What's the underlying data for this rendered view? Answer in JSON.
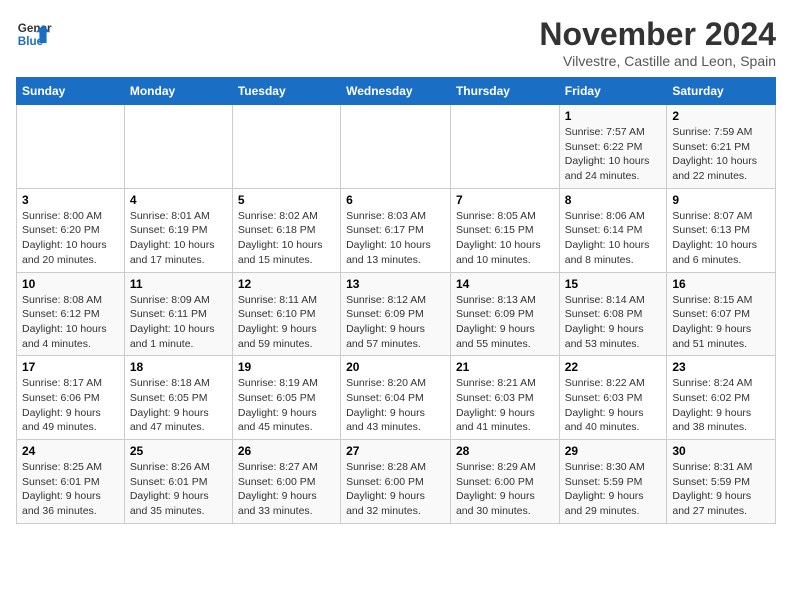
{
  "header": {
    "logo_line1": "General",
    "logo_line2": "Blue",
    "month": "November 2024",
    "location": "Vilvestre, Castille and Leon, Spain"
  },
  "weekdays": [
    "Sunday",
    "Monday",
    "Tuesday",
    "Wednesday",
    "Thursday",
    "Friday",
    "Saturday"
  ],
  "weeks": [
    [
      {
        "day": "",
        "info": ""
      },
      {
        "day": "",
        "info": ""
      },
      {
        "day": "",
        "info": ""
      },
      {
        "day": "",
        "info": ""
      },
      {
        "day": "",
        "info": ""
      },
      {
        "day": "1",
        "info": "Sunrise: 7:57 AM\nSunset: 6:22 PM\nDaylight: 10 hours and 24 minutes."
      },
      {
        "day": "2",
        "info": "Sunrise: 7:59 AM\nSunset: 6:21 PM\nDaylight: 10 hours and 22 minutes."
      }
    ],
    [
      {
        "day": "3",
        "info": "Sunrise: 8:00 AM\nSunset: 6:20 PM\nDaylight: 10 hours and 20 minutes."
      },
      {
        "day": "4",
        "info": "Sunrise: 8:01 AM\nSunset: 6:19 PM\nDaylight: 10 hours and 17 minutes."
      },
      {
        "day": "5",
        "info": "Sunrise: 8:02 AM\nSunset: 6:18 PM\nDaylight: 10 hours and 15 minutes."
      },
      {
        "day": "6",
        "info": "Sunrise: 8:03 AM\nSunset: 6:17 PM\nDaylight: 10 hours and 13 minutes."
      },
      {
        "day": "7",
        "info": "Sunrise: 8:05 AM\nSunset: 6:15 PM\nDaylight: 10 hours and 10 minutes."
      },
      {
        "day": "8",
        "info": "Sunrise: 8:06 AM\nSunset: 6:14 PM\nDaylight: 10 hours and 8 minutes."
      },
      {
        "day": "9",
        "info": "Sunrise: 8:07 AM\nSunset: 6:13 PM\nDaylight: 10 hours and 6 minutes."
      }
    ],
    [
      {
        "day": "10",
        "info": "Sunrise: 8:08 AM\nSunset: 6:12 PM\nDaylight: 10 hours and 4 minutes."
      },
      {
        "day": "11",
        "info": "Sunrise: 8:09 AM\nSunset: 6:11 PM\nDaylight: 10 hours and 1 minute."
      },
      {
        "day": "12",
        "info": "Sunrise: 8:11 AM\nSunset: 6:10 PM\nDaylight: 9 hours and 59 minutes."
      },
      {
        "day": "13",
        "info": "Sunrise: 8:12 AM\nSunset: 6:09 PM\nDaylight: 9 hours and 57 minutes."
      },
      {
        "day": "14",
        "info": "Sunrise: 8:13 AM\nSunset: 6:09 PM\nDaylight: 9 hours and 55 minutes."
      },
      {
        "day": "15",
        "info": "Sunrise: 8:14 AM\nSunset: 6:08 PM\nDaylight: 9 hours and 53 minutes."
      },
      {
        "day": "16",
        "info": "Sunrise: 8:15 AM\nSunset: 6:07 PM\nDaylight: 9 hours and 51 minutes."
      }
    ],
    [
      {
        "day": "17",
        "info": "Sunrise: 8:17 AM\nSunset: 6:06 PM\nDaylight: 9 hours and 49 minutes."
      },
      {
        "day": "18",
        "info": "Sunrise: 8:18 AM\nSunset: 6:05 PM\nDaylight: 9 hours and 47 minutes."
      },
      {
        "day": "19",
        "info": "Sunrise: 8:19 AM\nSunset: 6:05 PM\nDaylight: 9 hours and 45 minutes."
      },
      {
        "day": "20",
        "info": "Sunrise: 8:20 AM\nSunset: 6:04 PM\nDaylight: 9 hours and 43 minutes."
      },
      {
        "day": "21",
        "info": "Sunrise: 8:21 AM\nSunset: 6:03 PM\nDaylight: 9 hours and 41 minutes."
      },
      {
        "day": "22",
        "info": "Sunrise: 8:22 AM\nSunset: 6:03 PM\nDaylight: 9 hours and 40 minutes."
      },
      {
        "day": "23",
        "info": "Sunrise: 8:24 AM\nSunset: 6:02 PM\nDaylight: 9 hours and 38 minutes."
      }
    ],
    [
      {
        "day": "24",
        "info": "Sunrise: 8:25 AM\nSunset: 6:01 PM\nDaylight: 9 hours and 36 minutes."
      },
      {
        "day": "25",
        "info": "Sunrise: 8:26 AM\nSunset: 6:01 PM\nDaylight: 9 hours and 35 minutes."
      },
      {
        "day": "26",
        "info": "Sunrise: 8:27 AM\nSunset: 6:00 PM\nDaylight: 9 hours and 33 minutes."
      },
      {
        "day": "27",
        "info": "Sunrise: 8:28 AM\nSunset: 6:00 PM\nDaylight: 9 hours and 32 minutes."
      },
      {
        "day": "28",
        "info": "Sunrise: 8:29 AM\nSunset: 6:00 PM\nDaylight: 9 hours and 30 minutes."
      },
      {
        "day": "29",
        "info": "Sunrise: 8:30 AM\nSunset: 5:59 PM\nDaylight: 9 hours and 29 minutes."
      },
      {
        "day": "30",
        "info": "Sunrise: 8:31 AM\nSunset: 5:59 PM\nDaylight: 9 hours and 27 minutes."
      }
    ]
  ]
}
